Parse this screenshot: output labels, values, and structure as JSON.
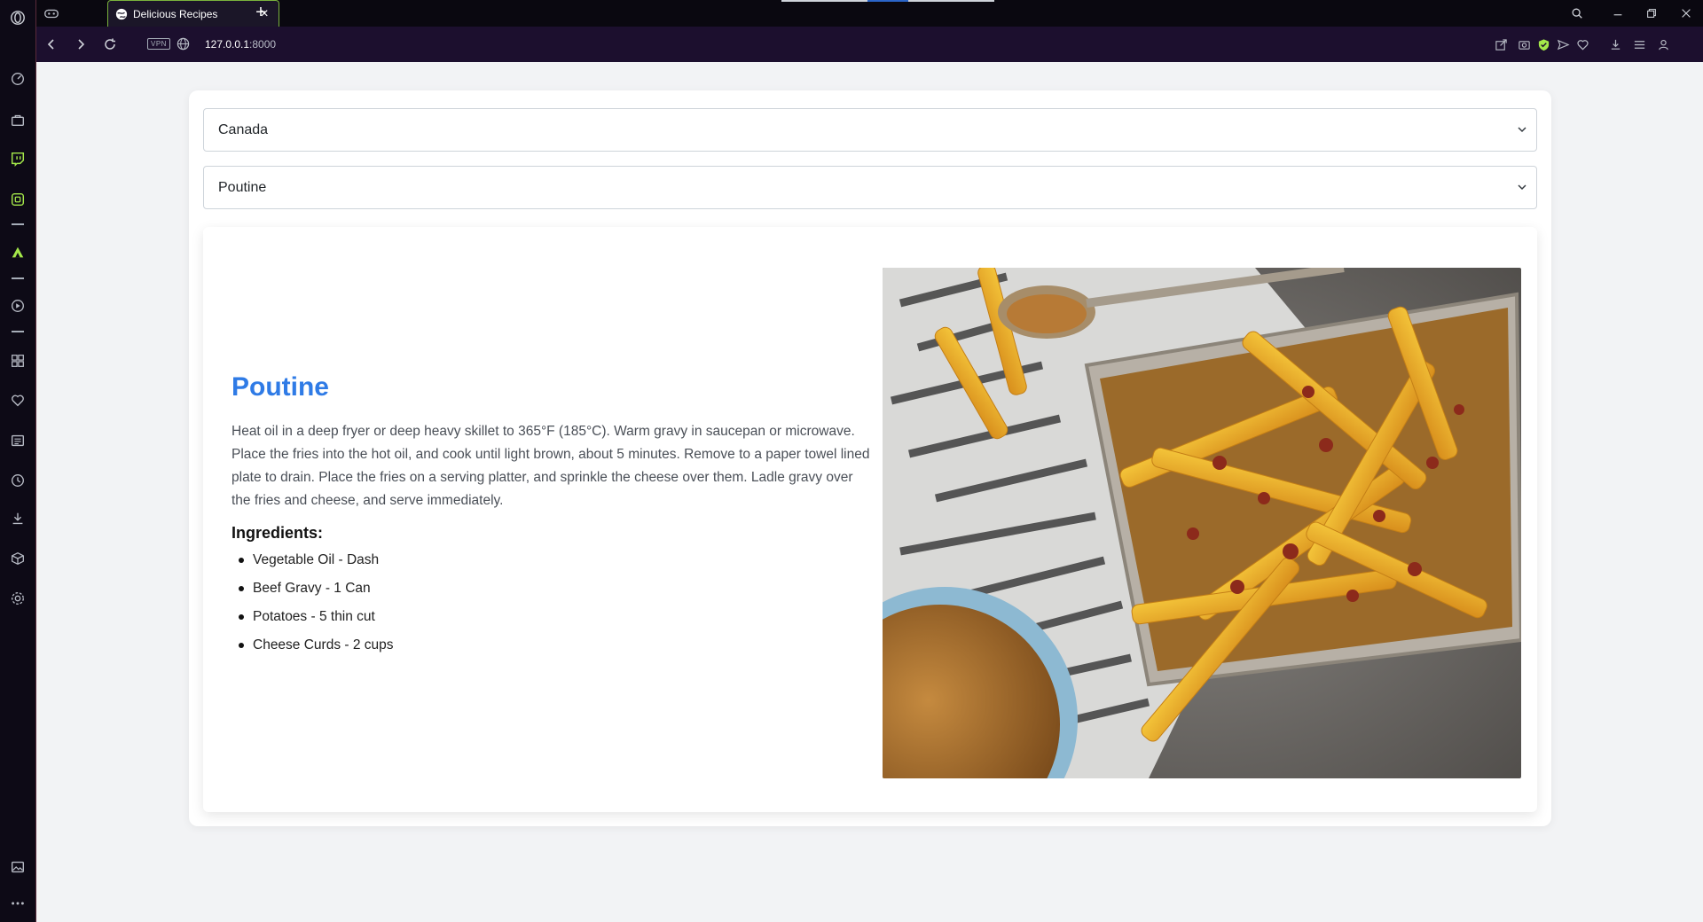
{
  "browser": {
    "tab_title": "Delicious Recipes",
    "new_tab_symbol": "+",
    "close_symbol": "×",
    "vpn_label": "VPN",
    "url_host": "127.0.0.1",
    "url_port": ":8000"
  },
  "sidebar_icons": [
    "speed-dial-icon",
    "bag-icon",
    "twitch-icon",
    "chat-icon",
    "aria-icon",
    "player-icon",
    "workspaces-icon",
    "heart-icon",
    "news-icon",
    "history-icon",
    "downloads-icon",
    "box-icon",
    "settings-icon",
    "gallery-icon",
    "more-icon"
  ],
  "selects": {
    "country": "Canada",
    "dish": "Poutine"
  },
  "recipe": {
    "title": "Poutine",
    "description": "Heat oil in a deep fryer or deep heavy skillet to 365°F (185°C). Warm gravy in saucepan or microwave. Place the fries into the hot oil, and cook until light brown, about 5 minutes. Remove to a paper towel lined plate to drain. Place the fries on a serving platter, and sprinkle the cheese over them. Ladle gravy over the fries and cheese, and serve immediately.",
    "ingredients_heading": "Ingredients:",
    "ingredients": [
      "Vegetable Oil - Dash",
      "Beef Gravy - 1 Can",
      "Potatoes - 5 thin cut",
      "Cheese Curds - 2 cups"
    ]
  },
  "colors": {
    "accent": "#2f7be6",
    "browser_green": "#7ab33c"
  }
}
